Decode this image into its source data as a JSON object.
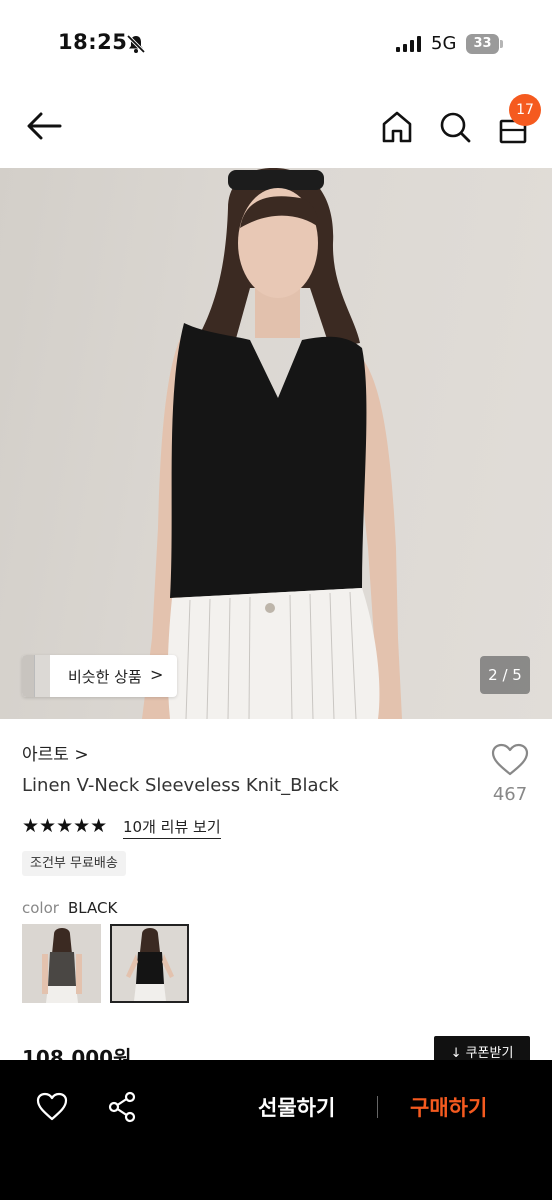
{
  "status_bar": {
    "time": "18:25",
    "network": "5G",
    "battery": "33"
  },
  "header": {
    "cart_count": "17",
    "icons": [
      "back-arrow-icon",
      "home-icon",
      "search-icon",
      "shopping-bag-icon"
    ]
  },
  "gallery": {
    "similar_label": "비슷한 상품",
    "similar_chevron": ">",
    "counter": "2 / 5"
  },
  "product": {
    "brand": "아르토 >",
    "name": "Linen V-Neck Sleeveless Knit_Black",
    "wish_count": "467",
    "rating_stars": "★★★★★",
    "review_link": "10개 리뷰 보기",
    "shipping_badge": "조건부 무료배송",
    "color_label": "color",
    "color_value": "BLACK",
    "price": "108,000원",
    "coupon_label": "↓ 쿠폰받기"
  },
  "bottom_bar": {
    "gift_label": "선물하기",
    "buy_label": "구매하기"
  },
  "colors": {
    "accent": "#f55a1f",
    "bottom_bar_bg": "#000000"
  }
}
